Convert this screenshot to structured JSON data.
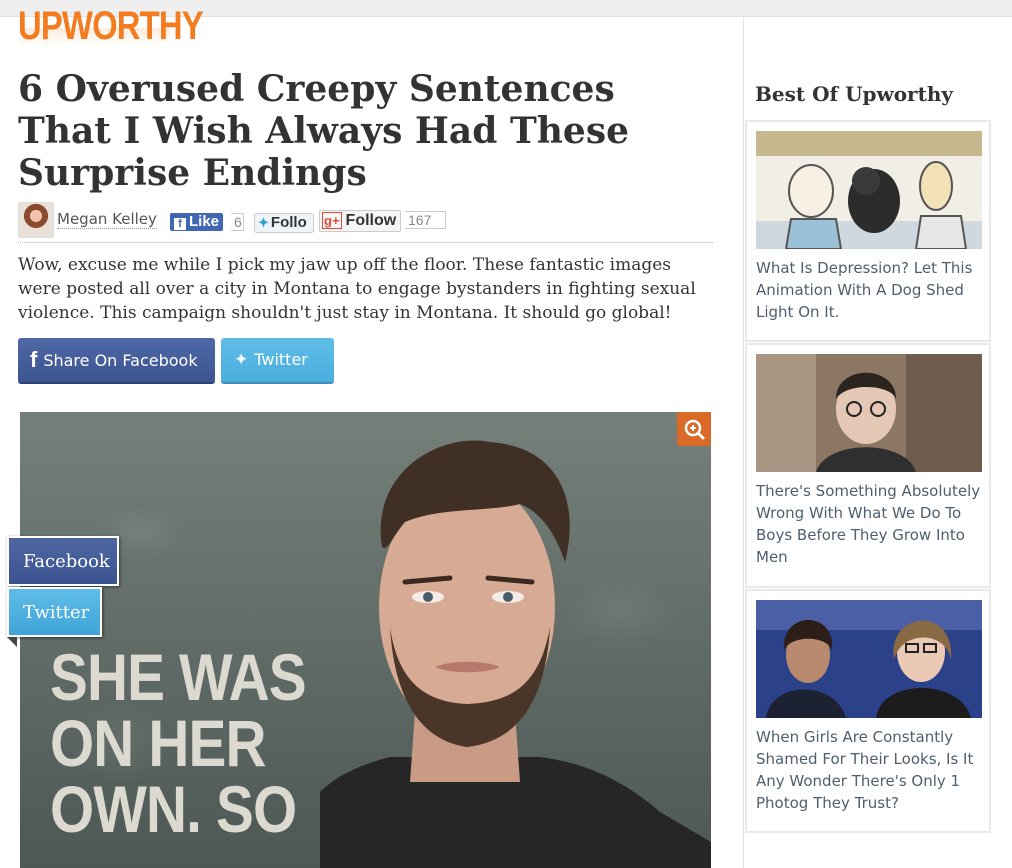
{
  "brand": {
    "logo_text": "UPWORTHY",
    "accent_color": "#f47c20"
  },
  "article": {
    "title": "6 Overused Creepy Sentences That I Wish Always Had These Surprise Endings",
    "author": "Megan Kelley",
    "intro": "Wow, excuse me while I pick my jaw up off the floor. These fantastic images were posted all over a city in Montana to engage bystanders in fighting sexual violence. This campaign shouldn't just stay in Montana. It should go global!"
  },
  "social": {
    "fb_like_label": "Like",
    "fb_like_count": "6",
    "twitter_follow_label": "Follo",
    "gplus_follow_label": "Follow",
    "gplus_follow_count": "167"
  },
  "share": {
    "facebook_label": "Share On Facebook",
    "twitter_label": "Twitter",
    "facebook_color": "#3f5893",
    "twitter_color": "#55b5e3"
  },
  "hero": {
    "overlay_text": "SHE WAS\nON HER\nOWN. SO",
    "zoom_icon": "zoom-in-icon"
  },
  "floating_share": {
    "facebook_label": "Facebook",
    "twitter_label": "Twitter"
  },
  "sidebar": {
    "heading": "Best Of Upworthy",
    "items": [
      {
        "caption": "What Is Depression? Let This Animation With A Dog Shed Light On It."
      },
      {
        "caption": "There's Something Absolutely Wrong With What We Do To Boys Before They Grow Into Men"
      },
      {
        "caption": "When Girls Are Constantly Shamed For Their Looks, Is It Any Wonder There's Only 1 Photog They Trust?"
      }
    ]
  }
}
